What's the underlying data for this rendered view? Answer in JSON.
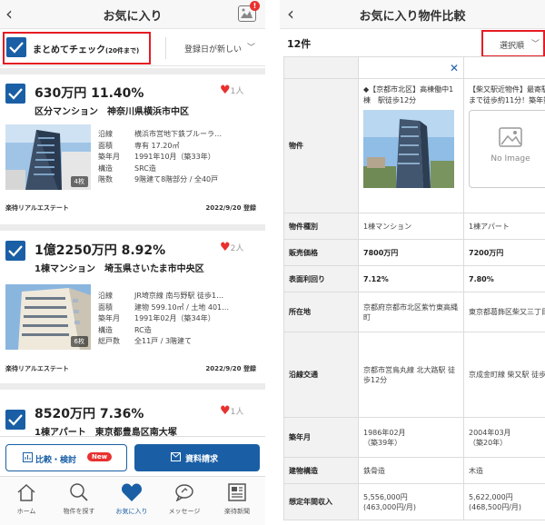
{
  "left": {
    "header_title": "お気に入り",
    "badge": "!",
    "bulk_check_label": "まとめてチェック",
    "bulk_check_note": "(20件まで)",
    "sort_label": "登録日が新しい",
    "cards": [
      {
        "price": "630万円 11.40%",
        "type_loc": "区分マンション　神奈川県横浜市中区",
        "fav": "1人",
        "photo_count": "4枚",
        "specs": [
          {
            "k": "沿線",
            "v": "横浜市営地下鉄ブルーラ…"
          },
          {
            "k": "面積",
            "v": "専有 17.20㎡"
          },
          {
            "k": "築年月",
            "v": "1991年10月（築33年）"
          },
          {
            "k": "構造",
            "v": "SRC造"
          },
          {
            "k": "階数",
            "v": "9階建て8階部分 / 全40戸"
          }
        ],
        "agent": "楽待リアルエステート",
        "date": "2022/9/20 登録"
      },
      {
        "price": "1億2250万円 8.92%",
        "type_loc": "1棟マンション　埼玉県さいたま市中央区",
        "fav": "2人",
        "photo_count": "6枚",
        "specs": [
          {
            "k": "沿線",
            "v": "JR埼京線 南与野駅 徒歩1…"
          },
          {
            "k": "面積",
            "v": "建物 599.10㎡ / 土地 401…"
          },
          {
            "k": "築年月",
            "v": "1991年02月（築34年）"
          },
          {
            "k": "構造",
            "v": "RC造"
          },
          {
            "k": "総戸数",
            "v": "全11戸 / 3階建て"
          }
        ],
        "agent": "楽待リアルエステート",
        "date": "2022/9/20 登録"
      },
      {
        "price": "8520万円 7.36%",
        "type_loc": "1棟アパート　東京都豊島区南大塚",
        "fav": "1人"
      }
    ],
    "compare_label": "比較・検討",
    "new_badge": "New",
    "docs_label": "資料請求",
    "tabs": [
      {
        "label": "ホーム",
        "icon": "home-icon"
      },
      {
        "label": "物件を探す",
        "icon": "search-icon"
      },
      {
        "label": "お気に入り",
        "icon": "heart-icon"
      },
      {
        "label": "メッセージ",
        "icon": "chat-icon"
      },
      {
        "label": "楽待新聞",
        "icon": "newspaper-icon"
      }
    ]
  },
  "right": {
    "header_title": "お気に入り物件比較",
    "count": "12件",
    "sort_label": "選択順",
    "no_image": "No Image",
    "rows": {
      "property": "物件",
      "kind": "物件種別",
      "price": "販売価格",
      "yield": "表面利回り",
      "address": "所在地",
      "access": "沿線交通",
      "built": "築年月",
      "structure": "建物構造",
      "income": "想定年間収入"
    },
    "col1": {
      "name": "◆【京都市北区】高棟働中1棟　駅徒歩12分",
      "kind": "1棟マンション",
      "price": "7800万円",
      "yield": "7.12%",
      "address": "京都府京都市北区紫竹東高縄町",
      "access": "京都市営鳥丸線 北大路駅 徒歩12分",
      "built": "1986年02月",
      "built_age": "（築39年）",
      "structure": "鉄骨造",
      "income": "5,556,000円",
      "income_month": "(463,000円/月)"
    },
    "col2": {
      "name": "【柴又駅近物件】最寄駅まで徒歩約11分！築年数",
      "kind": "1棟アパート",
      "price": "7200万円",
      "yield": "7.80%",
      "address": "東京都葛飾区柴又三丁目",
      "access": "京成金町線 柴又駅 徒歩",
      "built": "2004年03月",
      "built_age": "（築20年）",
      "structure": "木造",
      "income": "5,622,000円",
      "income_month": "(468,500円/月)"
    }
  },
  "colors": {
    "accent": "#1a5fa5",
    "highlight_border": "#e51c23",
    "heart": "#e8312f"
  }
}
